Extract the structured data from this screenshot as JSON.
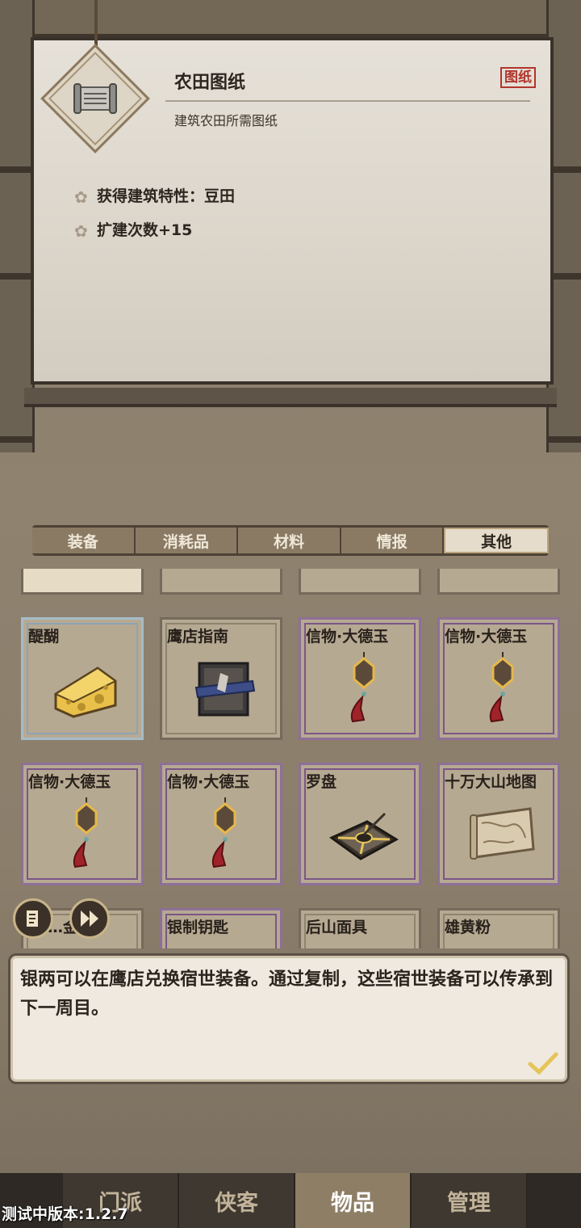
{
  "item": {
    "title": "农田图纸",
    "tag": "图纸",
    "description": "建筑农田所需图纸",
    "properties": [
      "获得建筑特性：豆田",
      "扩建次数+15"
    ]
  },
  "tabs": [
    {
      "label": "装备",
      "active": false
    },
    {
      "label": "消耗品",
      "active": false
    },
    {
      "label": "材料",
      "active": false
    },
    {
      "label": "情报",
      "active": false
    },
    {
      "label": "其他",
      "active": true
    }
  ],
  "grid": {
    "rows": [
      [
        {
          "name": "醍醐",
          "icon": "cheese-icon",
          "rarity": "blue"
        },
        {
          "name": "鹰店指南",
          "icon": "book-icon",
          "rarity": "normal"
        },
        {
          "name": "信物·大德玉",
          "icon": "jade-pendant-icon",
          "rarity": "purple"
        },
        {
          "name": "信物·大德玉",
          "icon": "jade-pendant-icon",
          "rarity": "purple"
        }
      ],
      [
        {
          "name": "信物·大德玉",
          "icon": "jade-pendant-icon",
          "rarity": "purple"
        },
        {
          "name": "信物·大德玉",
          "icon": "jade-pendant-icon",
          "rarity": "purple"
        },
        {
          "name": "罗盘",
          "icon": "compass-icon",
          "rarity": "purple"
        },
        {
          "name": "十万大山地图",
          "icon": "map-scroll-icon",
          "rarity": "purple"
        }
      ],
      [
        {
          "name": "…金符",
          "icon": "talisman-icon",
          "rarity": "normal"
        },
        {
          "name": "银制钥匙",
          "icon": "key-icon",
          "rarity": "purple"
        },
        {
          "name": "后山面具",
          "icon": "mask-icon",
          "rarity": "normal"
        },
        {
          "name": "雄黄粉",
          "icon": "powder-icon",
          "rarity": "normal"
        }
      ]
    ]
  },
  "dialog": {
    "text": "银两可以在鹰店兑换宿世装备。通过复制，这些宿世装备可以传承到下一周目。"
  },
  "bottom_nav": [
    {
      "label": "门派",
      "active": false
    },
    {
      "label": "侠客",
      "active": false
    },
    {
      "label": "物品",
      "active": true
    },
    {
      "label": "管理",
      "active": false
    }
  ],
  "version": "测试中版本:1.2.7"
}
